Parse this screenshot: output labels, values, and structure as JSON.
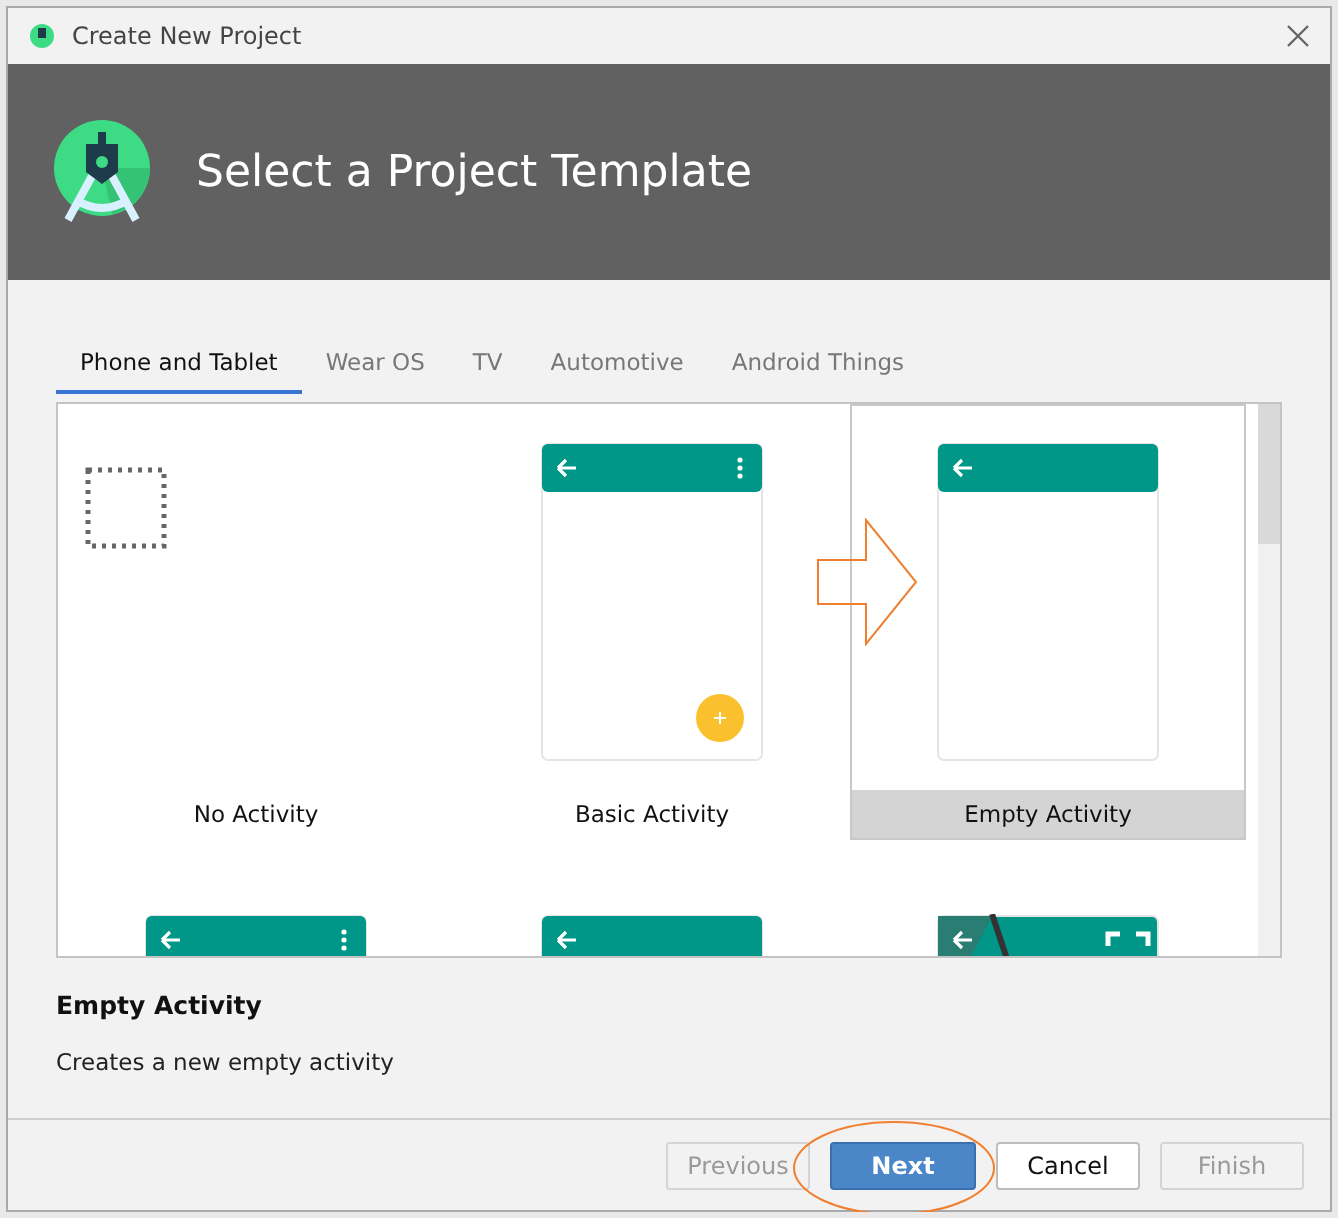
{
  "window": {
    "title": "Create New Project"
  },
  "header": {
    "title": "Select a Project Template"
  },
  "tabs": [
    {
      "label": "Phone and Tablet",
      "selected": true
    },
    {
      "label": "Wear OS",
      "selected": false
    },
    {
      "label": "TV",
      "selected": false
    },
    {
      "label": "Automotive",
      "selected": false
    },
    {
      "label": "Android Things",
      "selected": false
    }
  ],
  "templates": [
    {
      "name": "No Activity",
      "kind": "none",
      "selected": false
    },
    {
      "name": "Basic Activity",
      "kind": "basic",
      "selected": false
    },
    {
      "name": "Empty Activity",
      "kind": "empty",
      "selected": true
    },
    {
      "kind": "menu",
      "selected": false
    },
    {
      "kind": "empty",
      "selected": false
    },
    {
      "kind": "fullscreen",
      "selected": false
    }
  ],
  "description": {
    "title": "Empty Activity",
    "text": "Creates a new empty activity"
  },
  "buttons": [
    {
      "label": "Previous",
      "kind": "normal",
      "disabled": true
    },
    {
      "label": "Next",
      "kind": "default",
      "disabled": false
    },
    {
      "label": "Cancel",
      "kind": "normal",
      "disabled": false
    },
    {
      "label": "Finish",
      "kind": "normal",
      "disabled": true
    }
  ]
}
